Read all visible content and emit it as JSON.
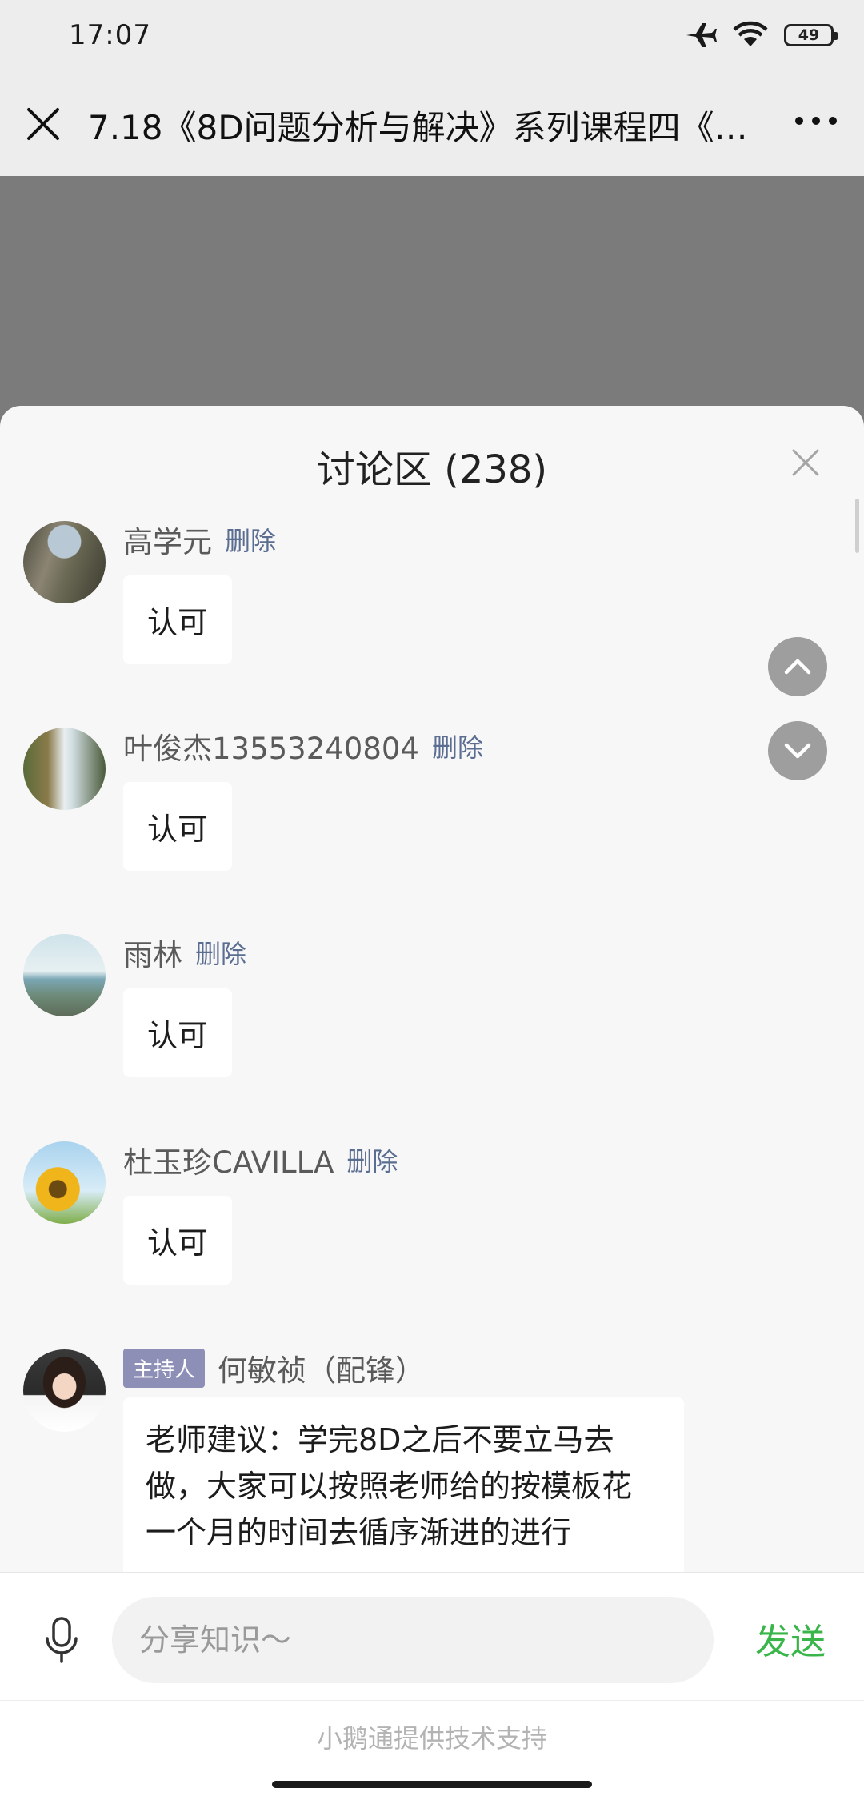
{
  "status_bar": {
    "time": "17:07",
    "battery": "49"
  },
  "header": {
    "title": "7.18《8D问题分析与解决》系列课程四《…"
  },
  "discussion": {
    "title": "讨论区 (238)",
    "messages": [
      {
        "name": "高学元",
        "action": "删除",
        "text": "认可"
      },
      {
        "name": "叶俊杰13553240804",
        "action": "删除",
        "text": "认可"
      },
      {
        "name": "雨林",
        "action": "删除",
        "text": "认可"
      },
      {
        "name": "杜玉珍CAVILLA",
        "action": "删除",
        "text": "认可"
      },
      {
        "badge": "主持人",
        "name": "何敏祯（配锋）",
        "text": "老师建议：学完8D之后不要立马去做，大家可以按照老师给的按模板花一个月的时间去循序渐进的进行"
      }
    ]
  },
  "input": {
    "placeholder": "分享知识～",
    "send_label": "发送"
  },
  "footer": {
    "text": "小鹅通提供技术支持"
  },
  "icons": {
    "close": "close-icon",
    "more": "more-icon",
    "airplane": "airplane-icon",
    "wifi": "wifi-icon",
    "mic": "microphone-icon",
    "up": "chevron-up-icon",
    "down": "chevron-down-icon"
  },
  "colors": {
    "send": "#39b54a",
    "delete_link": "#5b6d91",
    "host_badge": "#8d8fb6"
  }
}
